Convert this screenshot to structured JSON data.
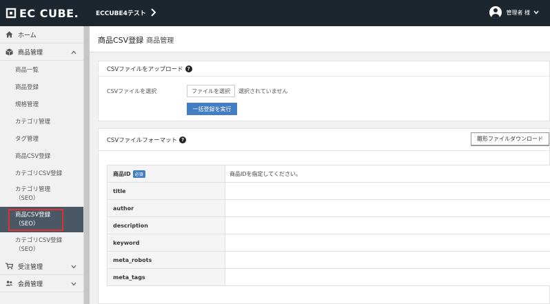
{
  "header": {
    "logo_text": "EC CUBE.",
    "shop_name": "ECCUBE4テスト",
    "user_name": "管理者 様"
  },
  "sidebar": {
    "items": [
      {
        "label": "ホーム",
        "icon": "home-icon"
      },
      {
        "label": "商品管理",
        "icon": "box-icon"
      },
      {
        "label": "受注管理",
        "icon": "cart-icon"
      },
      {
        "label": "会員管理",
        "icon": "users-icon"
      }
    ],
    "sub_items": [
      {
        "label": "商品一覧"
      },
      {
        "label": "商品登録"
      },
      {
        "label": "規格管理"
      },
      {
        "label": "カテゴリ管理"
      },
      {
        "label": "タグ管理"
      },
      {
        "label": "商品CSV登録"
      },
      {
        "label": "カテゴリCSV登録"
      },
      {
        "line1": "カテゴリ管理",
        "line2": "（SEO）"
      },
      {
        "line1": "商品CSV登録",
        "line2": "（SEO）"
      },
      {
        "line1": "カテゴリCSV登録",
        "line2": "（SEO）"
      }
    ]
  },
  "page": {
    "title": "商品CSV登録",
    "subtitle": "商品管理"
  },
  "upload_card": {
    "header": "CSVファイルをアップロード",
    "field_label": "CSVファイルを選択",
    "file_button": "ファイルを選択",
    "file_status": "選択されていません",
    "submit_label": "一括登録を実行"
  },
  "format_card": {
    "header": "CSVファイルフォーマット",
    "download_label": "雛形ファイルダウンロード",
    "required_badge": "必須",
    "rows": [
      {
        "key": "商品ID",
        "value": "商品IDを指定してください。"
      },
      {
        "key": "title",
        "value": ""
      },
      {
        "key": "author",
        "value": ""
      },
      {
        "key": "description",
        "value": ""
      },
      {
        "key": "keyword",
        "value": ""
      },
      {
        "key": "meta_robots",
        "value": ""
      },
      {
        "key": "meta_tags",
        "value": ""
      }
    ]
  },
  "colors": {
    "header_bg": "#1d262f",
    "accent": "#437ec4",
    "active_nav": "#4a5865",
    "highlight": "#e03030"
  }
}
